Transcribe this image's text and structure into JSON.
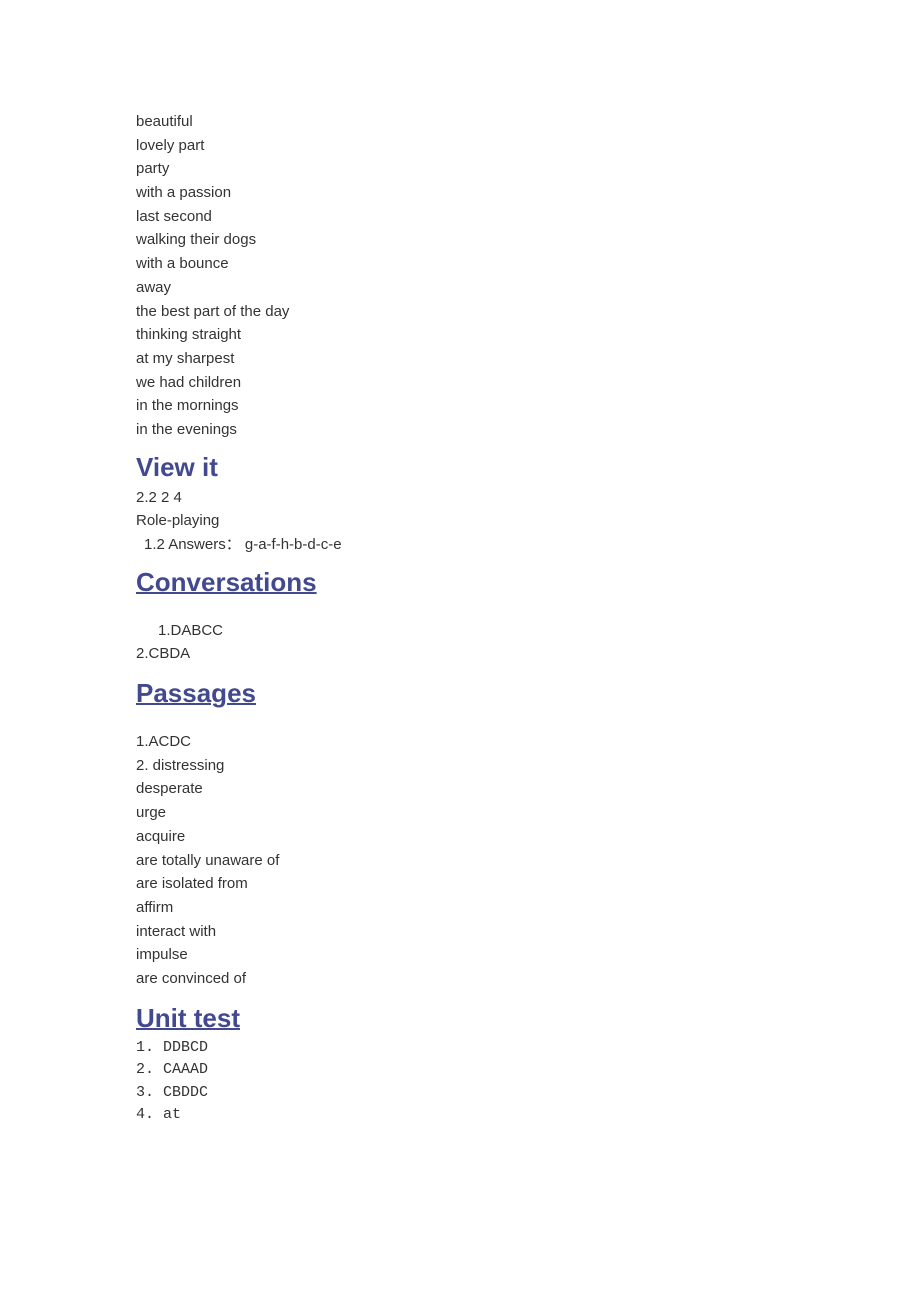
{
  "intro_words": [
    "beautiful",
    "lovely part",
    "party",
    "with a passion",
    "last second",
    "walking their dogs",
    "with a bounce",
    "away",
    "the best part of the day",
    "thinking straight",
    "at my sharpest",
    "we had children",
    "in the mornings",
    "in the evenings"
  ],
  "view_it": {
    "heading": "View it",
    "line1": "2.2 2 4",
    "line2": "Role-playing",
    "line3": "  1.2 Answers：  g-a-f-h-b-d-c-e"
  },
  "conversations": {
    "heading": "Conversations",
    "line1": "1.DABCC",
    "line2": "2.CBDA"
  },
  "passages": {
    "heading": "Passages",
    "items": [
      "1.ACDC",
      "2. distressing",
      "desperate",
      "urge",
      "acquire",
      "are totally unaware of",
      "are isolated from",
      "affirm",
      "interact with",
      "impulse",
      "are convinced of"
    ]
  },
  "unit_test": {
    "heading": "Unit test ",
    "items": [
      "1. DDBCD",
      "2. CAAAD",
      "3. CBDDC",
      "4. at"
    ]
  }
}
